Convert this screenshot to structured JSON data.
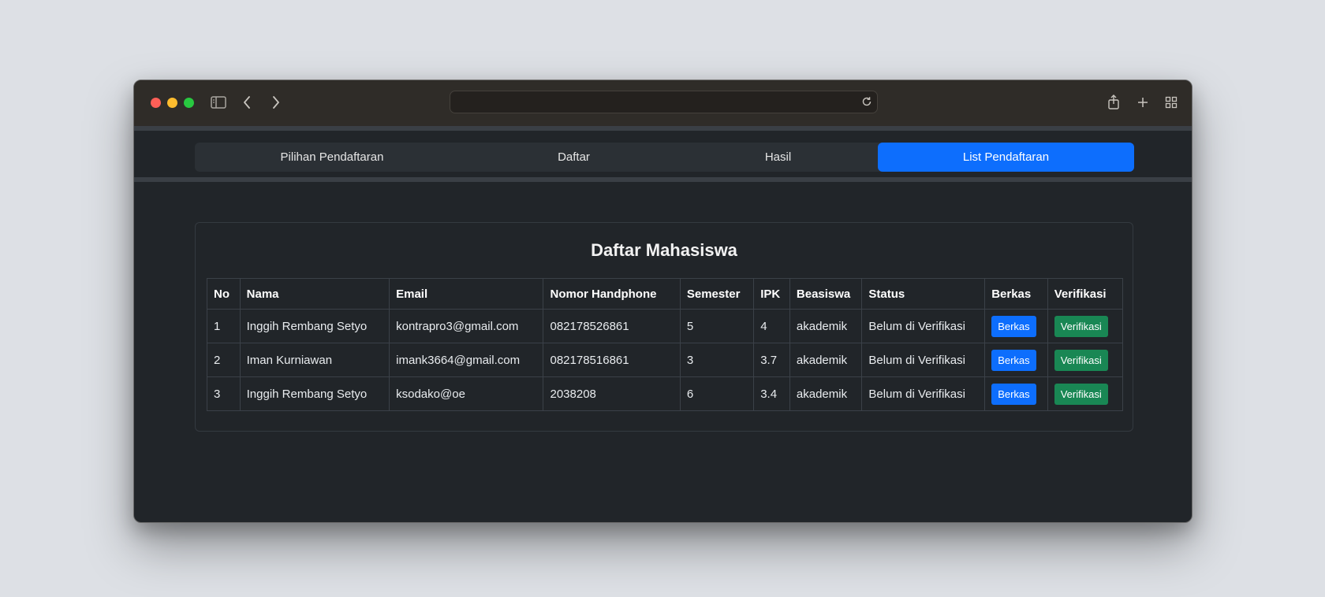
{
  "browser": {
    "icons": [
      "sidebar-icon",
      "back-icon",
      "forward-icon",
      "reload-icon",
      "share-icon",
      "new-tab-icon",
      "tab-overview-icon"
    ]
  },
  "nav": {
    "tabs": [
      {
        "label": "Pilihan Pendaftaran",
        "active": false
      },
      {
        "label": "Daftar",
        "active": false
      },
      {
        "label": "Hasil",
        "active": false
      },
      {
        "label": "List Pendaftaran",
        "active": true
      }
    ]
  },
  "card": {
    "title": "Daftar Mahasiswa"
  },
  "table": {
    "headers": [
      "No",
      "Nama",
      "Email",
      "Nomor Handphone",
      "Semester",
      "IPK",
      "Beasiswa",
      "Status",
      "Berkas",
      "Verifikasi"
    ],
    "rows": [
      {
        "no": "1",
        "nama": "Inggih Rembang Setyo",
        "email": "kontrapro3@gmail.com",
        "phone": "082178526861",
        "semester": "5",
        "ipk": "4",
        "beasiswa": "akademik",
        "status": "Belum di Verifikasi",
        "berkas": "Berkas",
        "verifikasi": "Verifikasi"
      },
      {
        "no": "2",
        "nama": "Iman Kurniawan",
        "email": "imank3664@gmail.com",
        "phone": "082178516861",
        "semester": "3",
        "ipk": "3.7",
        "beasiswa": "akademik",
        "status": "Belum di Verifikasi",
        "berkas": "Berkas",
        "verifikasi": "Verifikasi"
      },
      {
        "no": "3",
        "nama": "Inggih Rembang Setyo",
        "email": "ksodako@oe",
        "phone": "2038208",
        "semester": "6",
        "ipk": "3.4",
        "beasiswa": "akademik",
        "status": "Belum di Verifikasi",
        "berkas": "Berkas",
        "verifikasi": "Verifikasi"
      }
    ]
  },
  "colors": {
    "accent": "#0d6efd",
    "success": "#198754",
    "background": "#212529"
  }
}
